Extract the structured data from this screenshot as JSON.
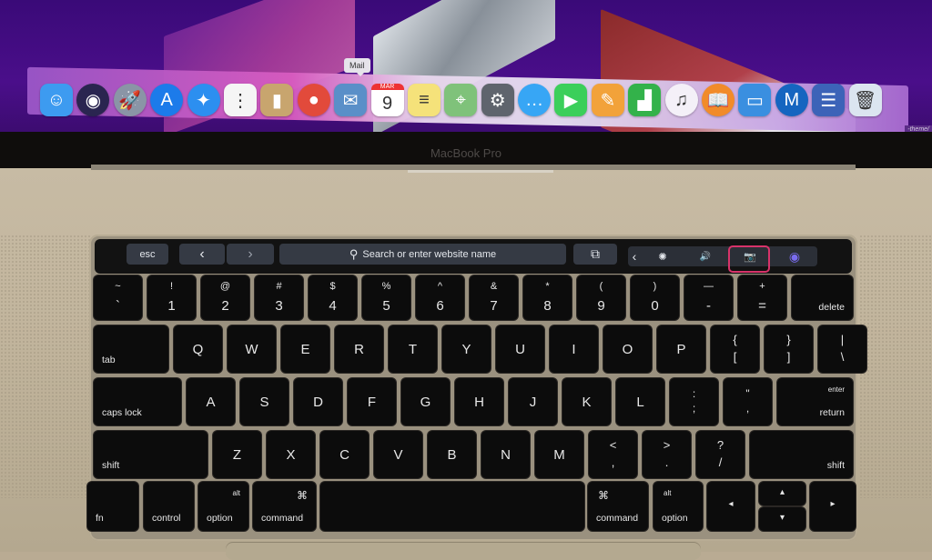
{
  "screen": {
    "tooltip": "Mail",
    "corner_label": "-theme/",
    "dock": [
      {
        "name": "finder",
        "glyph": "☺",
        "color": "#3d9bf0"
      },
      {
        "name": "siri",
        "glyph": "◉",
        "color": "#2a2550"
      },
      {
        "name": "launchpad",
        "glyph": "🚀",
        "color": "#8a95a6"
      },
      {
        "name": "app-store",
        "glyph": "A",
        "color": "#1c7bea"
      },
      {
        "name": "safari",
        "glyph": "✦",
        "color": "#2c8ff0"
      },
      {
        "name": "reminders",
        "glyph": "⋮",
        "color": "#f5f5f5"
      },
      {
        "name": "contacts",
        "glyph": "▮",
        "color": "#c8a56e"
      },
      {
        "name": "chrome",
        "glyph": "●",
        "color": "#e24a3b"
      },
      {
        "name": "mail-preview",
        "glyph": "✉",
        "color": "#5a8fc8"
      },
      {
        "name": "calendar",
        "glyph": "9",
        "color": "#ffffff",
        "month": "MAR"
      },
      {
        "name": "notes",
        "glyph": "≡",
        "color": "#f5e27a"
      },
      {
        "name": "maps",
        "glyph": "⌖",
        "color": "#7fc27a"
      },
      {
        "name": "system-preferences",
        "glyph": "⚙",
        "color": "#5f646d"
      },
      {
        "name": "messages",
        "glyph": "…",
        "color": "#37a6f5"
      },
      {
        "name": "facetime",
        "glyph": "▶",
        "color": "#3bcf5a"
      },
      {
        "name": "pages",
        "glyph": "✎",
        "color": "#f2a23a"
      },
      {
        "name": "numbers",
        "glyph": "▟",
        "color": "#33b24a"
      },
      {
        "name": "itunes",
        "glyph": "♫",
        "color": "#f4f0f8"
      },
      {
        "name": "ibooks",
        "glyph": "📖",
        "color": "#f18b2a"
      },
      {
        "name": "keynote",
        "glyph": "▭",
        "color": "#3a8fe0"
      },
      {
        "name": "mamp",
        "glyph": "M",
        "color": "#1565c0"
      },
      {
        "name": "stack",
        "glyph": "☰",
        "color": "#3c63b8"
      },
      {
        "name": "trash",
        "glyph": "🗑",
        "color": "#dbe5f0"
      }
    ]
  },
  "brand": "MacBook Pro",
  "touchbar": {
    "esc": "esc",
    "back": "‹",
    "forward": "›",
    "search_placeholder": "Search or enter website name",
    "search_icon": "⚲",
    "new_tab": "⧉",
    "collapse": "‹",
    "brightness": "✺",
    "volume": "🔊",
    "screenshot": "📷",
    "siri": "◉",
    "highlighted_control": "screenshot"
  },
  "keys": {
    "row1": [
      {
        "top": "~",
        "bot": "`"
      },
      {
        "top": "!",
        "bot": "1"
      },
      {
        "top": "@",
        "bot": "2"
      },
      {
        "top": "#",
        "bot": "3"
      },
      {
        "top": "$",
        "bot": "4"
      },
      {
        "top": "%",
        "bot": "5"
      },
      {
        "top": "^",
        "bot": "6"
      },
      {
        "top": "&",
        "bot": "7"
      },
      {
        "top": "*",
        "bot": "8"
      },
      {
        "top": "(",
        "bot": "9"
      },
      {
        "top": ")",
        "bot": "0"
      },
      {
        "top": "—",
        "bot": "-"
      },
      {
        "top": "+",
        "bot": "="
      }
    ],
    "delete": "delete",
    "tab": "tab",
    "row2": [
      "Q",
      "W",
      "E",
      "R",
      "T",
      "Y",
      "U",
      "I",
      "O",
      "P"
    ],
    "row2_sym": [
      {
        "top": "{",
        "bot": "["
      },
      {
        "top": "}",
        "bot": "]"
      },
      {
        "top": "|",
        "bot": "\\"
      }
    ],
    "caps_lock": "caps lock",
    "row3": [
      "A",
      "S",
      "D",
      "F",
      "G",
      "H",
      "J",
      "K",
      "L"
    ],
    "row3_sym": [
      {
        "top": ":",
        "bot": ";"
      },
      {
        "top": "\"",
        "bot": ","
      }
    ],
    "enter": "enter",
    "return": "return",
    "shift": "shift",
    "row4": [
      "Z",
      "X",
      "C",
      "V",
      "B",
      "N",
      "M"
    ],
    "row4_sym": [
      {
        "top": "<",
        "bot": ","
      },
      {
        "top": ">",
        "bot": "."
      },
      {
        "top": "?",
        "bot": "/"
      }
    ],
    "fn": "fn",
    "control": "control",
    "alt": "alt",
    "option": "option",
    "cmd_symbol": "⌘",
    "command": "command",
    "arrow_left": "◂",
    "arrow_up": "▴",
    "arrow_down": "▾",
    "arrow_right": "▸"
  }
}
